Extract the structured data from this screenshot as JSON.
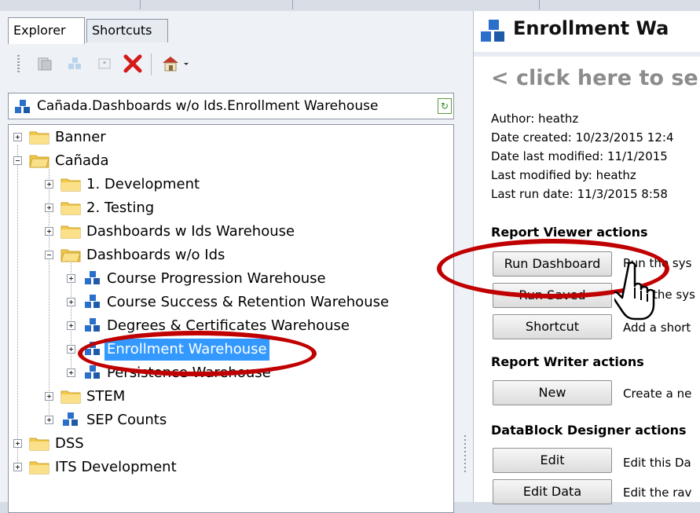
{
  "left": {
    "tabs": [
      {
        "label": "Explorer"
      },
      {
        "label": "Shortcuts"
      }
    ],
    "toolbar": {
      "icons": [
        "open-icon",
        "new-dashboard-icon",
        "quote-icon",
        "delete-icon",
        "warehouse-icon",
        "dropdown-arrow-icon"
      ],
      "delete_color": "#d41a1a"
    },
    "path": "Cañada.Dashboards w/o Ids.Enrollment Warehouse",
    "tree": [
      {
        "label": "Banner"
      },
      {
        "label": "Cañada"
      },
      {
        "label": "1. Development"
      },
      {
        "label": "2. Testing"
      },
      {
        "label": "Dashboards w Ids Warehouse"
      },
      {
        "label": "Dashboards w/o Ids"
      },
      {
        "label": "Course Progression Warehouse"
      },
      {
        "label": "Course Success & Retention Warehouse"
      },
      {
        "label": "Degrees & Certificates Warehouse"
      },
      {
        "label": "Enrollment Warehouse",
        "selected": true
      },
      {
        "label": "Persistence Warehouse"
      },
      {
        "label": "STEM"
      },
      {
        "label": "SEP Counts"
      },
      {
        "label": "DSS"
      },
      {
        "label": "ITS Development"
      }
    ]
  },
  "right": {
    "title": "Enrollment Wa",
    "click_here": "< click here to se",
    "meta": [
      "Author: heathz",
      "Date created: 10/23/2015 12:4",
      "Date last modified: 11/1/2015",
      "Last modified by: heathz",
      "Last run date: 11/3/2015 8:58"
    ],
    "viewer": {
      "heading": "Report Viewer actions",
      "buttons": [
        {
          "label": "Run Dashboard",
          "desc": "Run the sys"
        },
        {
          "label": "Run Saved",
          "desc": "the sys"
        },
        {
          "label": "Shortcut",
          "desc": "Add a short"
        }
      ]
    },
    "writer": {
      "heading": "Report Writer actions",
      "buttons": [
        {
          "label": "New",
          "desc": "Create a ne"
        }
      ]
    },
    "designer": {
      "heading": "DataBlock Designer actions",
      "buttons": [
        {
          "label": "Edit",
          "desc": "Edit this Da"
        },
        {
          "label": "Edit Data",
          "desc": "Edit the rav"
        }
      ]
    }
  },
  "colors": {
    "highlight": "#c00000",
    "selection": "#3399ff",
    "folder": "#f3c94a",
    "warehouse": "#2a6fc9"
  }
}
